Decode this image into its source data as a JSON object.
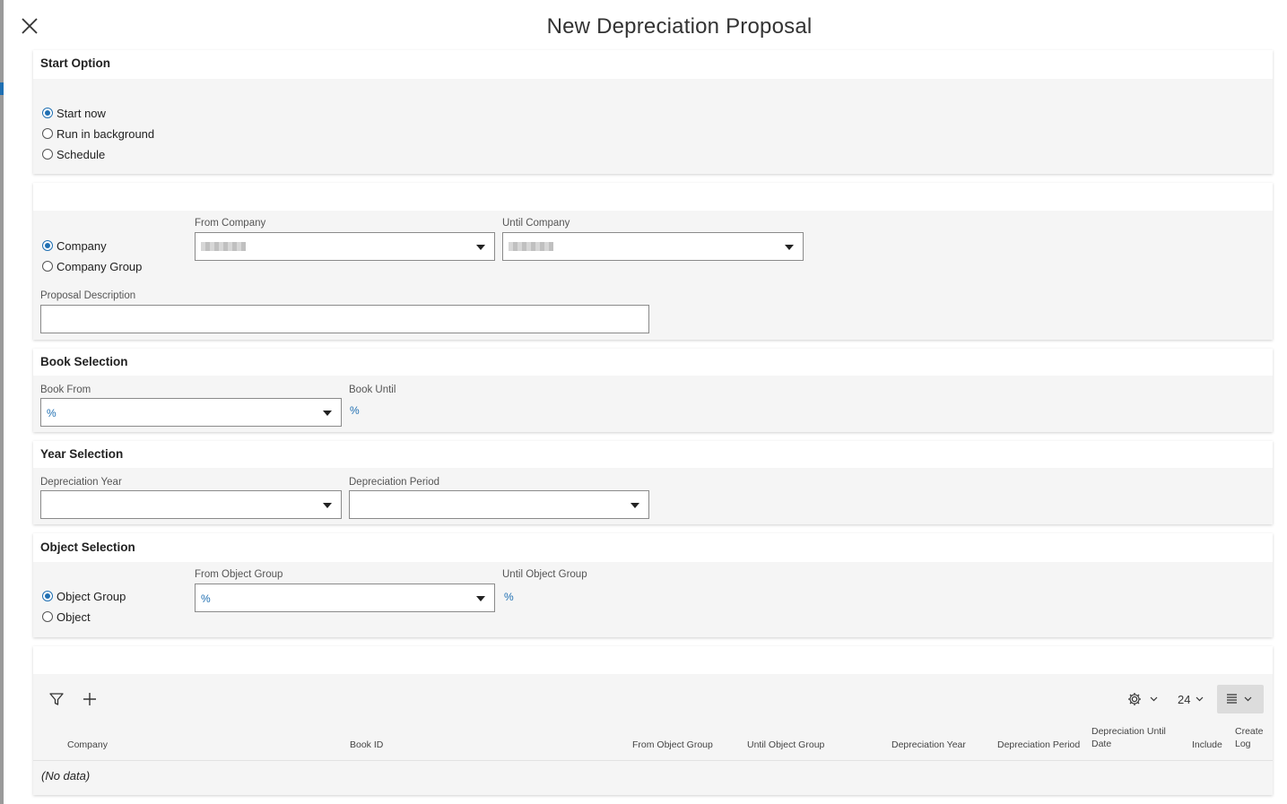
{
  "dialog": {
    "title": "New Depreciation Proposal"
  },
  "start_option": {
    "title": "Start Option",
    "options": [
      {
        "label": "Start now",
        "selected": true
      },
      {
        "label": "Run in background",
        "selected": false
      },
      {
        "label": "Schedule",
        "selected": false
      }
    ]
  },
  "company": {
    "options": [
      {
        "label": "Company",
        "selected": true
      },
      {
        "label": "Company Group",
        "selected": false
      }
    ],
    "from_label": "From Company",
    "until_label": "Until Company",
    "description_label": "Proposal Description",
    "description_value": ""
  },
  "book_selection": {
    "title": "Book Selection",
    "from_label": "Book From",
    "from_value": "%",
    "until_label": "Book Until",
    "until_value": "%"
  },
  "year_selection": {
    "title": "Year Selection",
    "year_label": "Depreciation Year",
    "year_value": "",
    "period_label": "Depreciation Period",
    "period_value": ""
  },
  "object_selection": {
    "title": "Object Selection",
    "options": [
      {
        "label": "Object Group",
        "selected": true
      },
      {
        "label": "Object",
        "selected": false
      }
    ],
    "from_label": "From Object Group",
    "from_value": "%",
    "until_label": "Until Object Group",
    "until_value": "%"
  },
  "table": {
    "page_size": "24",
    "columns": [
      "Company",
      "Book ID",
      "From Object Group",
      "Until Object Group",
      "Depreciation Year",
      "Depreciation Period",
      "Depreciation Until Date",
      "Include",
      "Create Log"
    ],
    "empty_text": "(No data)"
  },
  "colors": {
    "accent": "#1f6fb2",
    "panel_bg": "#f5f5f5"
  }
}
